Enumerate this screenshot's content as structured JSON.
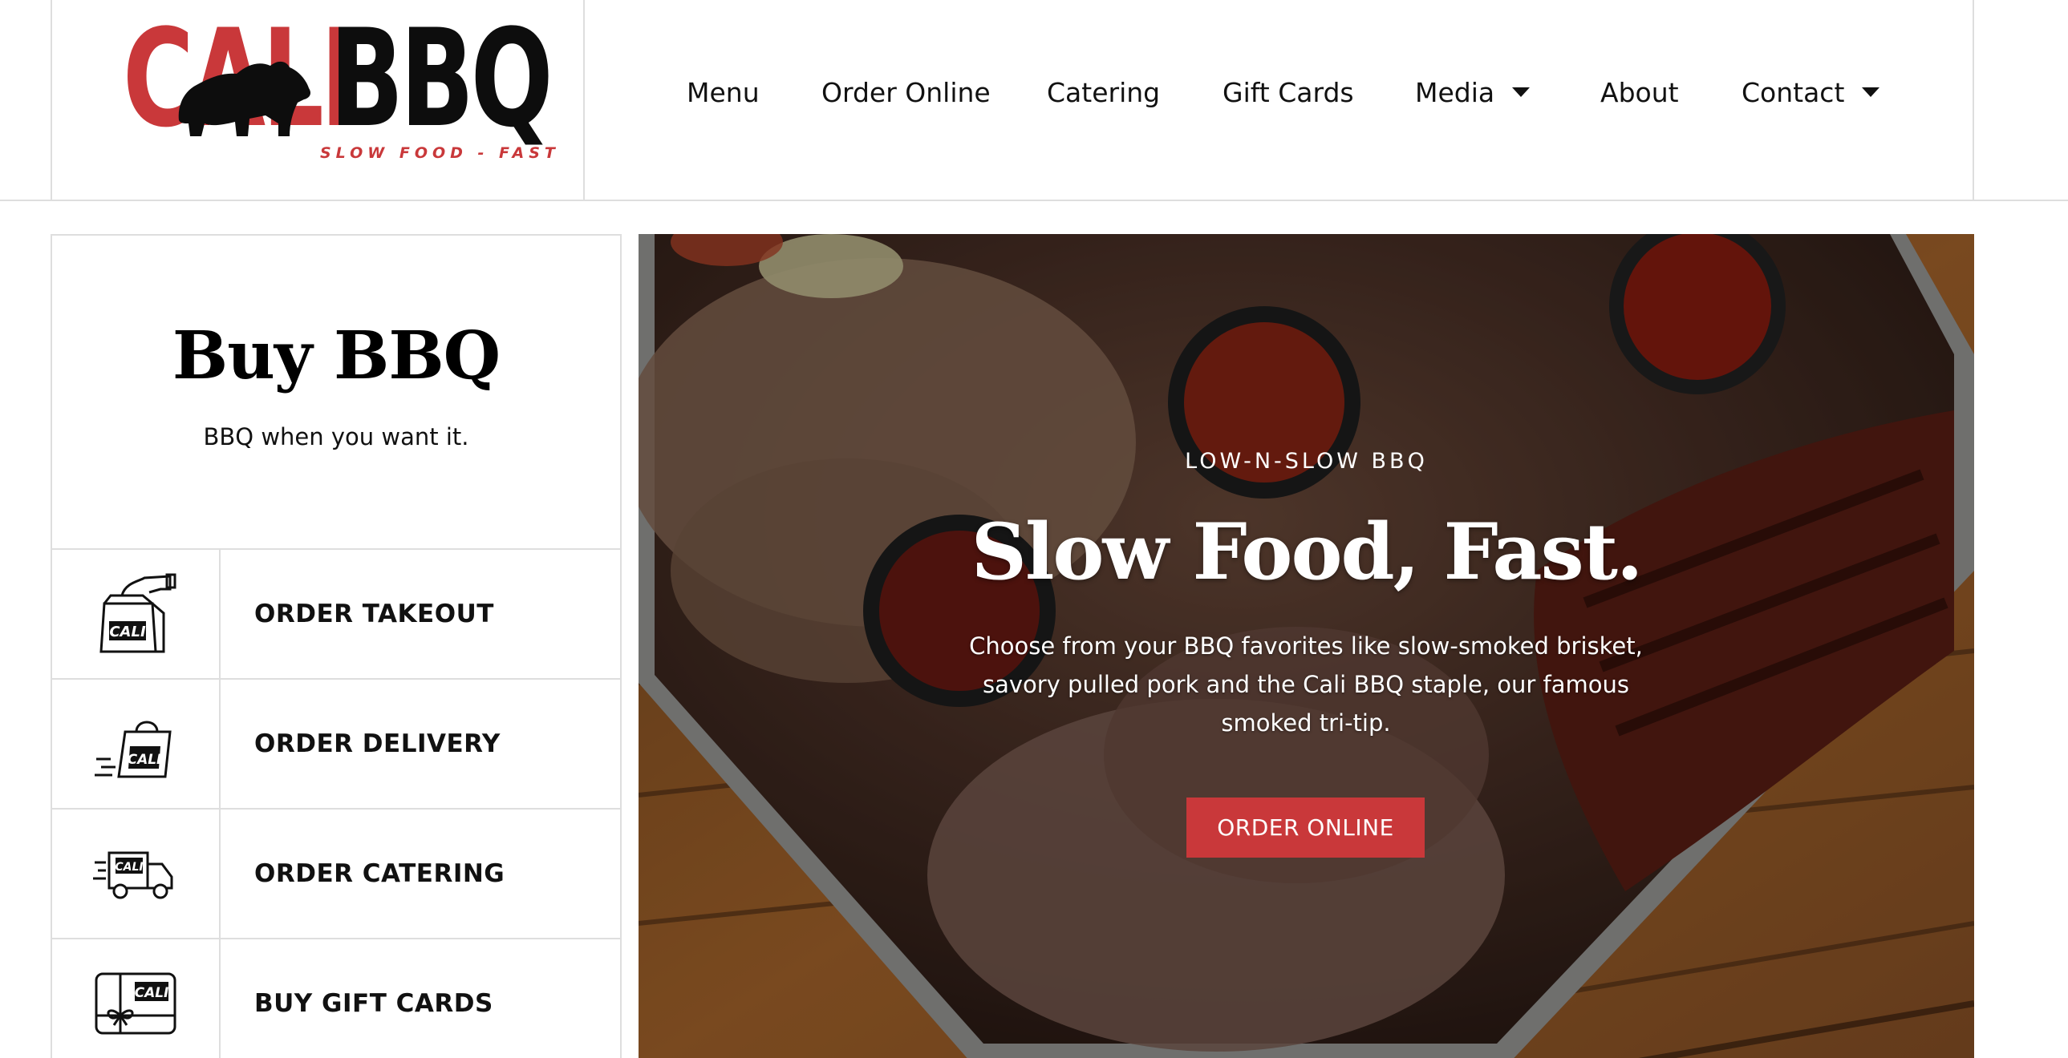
{
  "brand": {
    "logo_word_left": "CALI",
    "logo_word_right": "BBQ",
    "tagline": "SLOW FOOD - FAST",
    "colors": {
      "accent_red": "#c9383a",
      "ink": "#0d0d0d",
      "border": "#dedede"
    }
  },
  "nav": {
    "items": [
      {
        "label": "Menu",
        "has_dropdown": false
      },
      {
        "label": "Order Online",
        "has_dropdown": false
      },
      {
        "label": "Catering",
        "has_dropdown": false
      },
      {
        "label": "Gift Cards",
        "has_dropdown": false
      },
      {
        "label": "Media",
        "has_dropdown": true,
        "icon": "chevron-down-icon"
      },
      {
        "label": "About",
        "has_dropdown": false
      },
      {
        "label": "Contact",
        "has_dropdown": true,
        "icon": "chevron-down-icon"
      }
    ]
  },
  "buy_panel": {
    "title": "Buy BBQ",
    "subtitle": "BBQ when you want it.",
    "actions": [
      {
        "label": "ORDER TAKEOUT",
        "icon": "takeout-bag-icon"
      },
      {
        "label": "ORDER DELIVERY",
        "icon": "delivery-bag-icon"
      },
      {
        "label": "ORDER CATERING",
        "icon": "catering-truck-icon"
      },
      {
        "label": "BUY GIFT CARDS",
        "icon": "gift-card-icon"
      }
    ]
  },
  "hero": {
    "kicker": "LOW-N-SLOW BBQ",
    "title": "Slow Food, Fast.",
    "body": "Choose from your BBQ favorites like slow-smoked brisket, savory pulled pork and the Cali BBQ staple, our famous smoked tri-tip.",
    "cta_label": "ORDER ONLINE"
  }
}
